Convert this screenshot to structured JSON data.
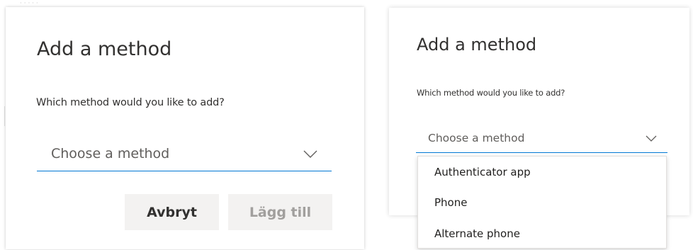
{
  "left_dialog": {
    "title": "Add a method",
    "question": "Which method would you like to add?",
    "dropdown_value": "Choose a method",
    "cancel_label": "Avbryt",
    "add_label": "Lägg till"
  },
  "right_dialog": {
    "title": "Add a method",
    "question": "Which method would you like to add?",
    "dropdown_value": "Choose a method",
    "options": [
      "Authenticator app",
      "Phone",
      "Alternate phone"
    ]
  },
  "colors": {
    "accent": "#0078d4",
    "text": "#323130",
    "placeholder": "#605e5c",
    "button_bg": "#f3f2f1",
    "disabled_text": "#a19f9d"
  },
  "icons": {
    "dropdown": "chevron-down-icon"
  }
}
